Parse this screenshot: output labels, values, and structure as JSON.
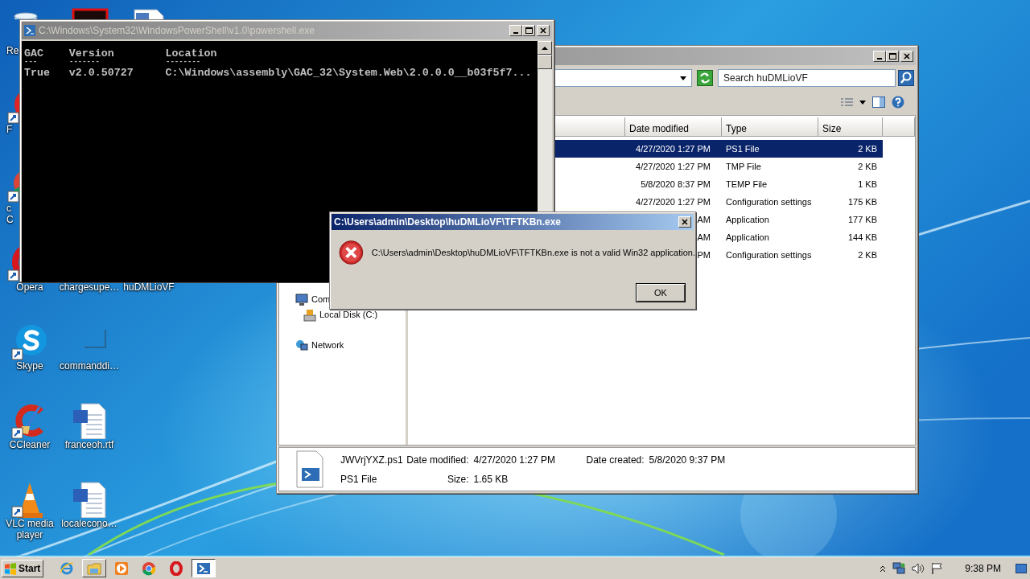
{
  "desktop_icons": [
    {
      "kind": "recycle-bin",
      "label": [
        "Re"
      ]
    },
    {
      "kind": "red-shortcut",
      "label": [
        "F"
      ]
    },
    {
      "kind": "chrome-shortcut",
      "label": [
        "c",
        "C"
      ]
    },
    {
      "kind": "opera",
      "label": [
        "Opera"
      ]
    },
    {
      "kind": "skype",
      "label": [
        "Skype"
      ]
    },
    {
      "kind": "ccleaner",
      "label": [
        "CCleaner"
      ]
    },
    {
      "kind": "vlc",
      "label": [
        "VLC media",
        "player"
      ]
    },
    {
      "kind": "red-box"
    },
    {
      "kind": "label-only",
      "label": [
        "chargesupe…"
      ]
    },
    {
      "kind": "blank",
      "label": [
        "commanddi…"
      ]
    },
    {
      "kind": "word",
      "label": [
        "franceoh.rtf"
      ]
    },
    {
      "kind": "word",
      "label": [
        "localecono…"
      ]
    },
    {
      "kind": "document"
    },
    {
      "kind": "label-only",
      "label": [
        "huDMLioVF"
      ]
    }
  ],
  "console_window": {
    "title": "C:\\Windows\\System32\\WindowsPowerShell\\v1.0\\powershell.exe",
    "lines": [
      [
        "GAC",
        "Version",
        "Location"
      ],
      [
        "---",
        "-------",
        "--------"
      ],
      [
        "True",
        "v2.0.50727",
        "C:\\Windows\\assembly\\GAC_32\\System.Web\\2.0.0.0__b03f5f7..."
      ]
    ]
  },
  "explorer_window": {
    "search": {
      "placeholder": "Search huDMLioVF"
    },
    "columns": [
      "Date modified",
      "Type",
      "Size"
    ],
    "rows": [
      {
        "date_modified": "4/27/2020 1:27 PM",
        "type": "PS1 File",
        "size": "2 KB",
        "selected": true
      },
      {
        "date_modified": "4/27/2020 1:27 PM",
        "type": "TMP File",
        "size": "2 KB",
        "selected": false
      },
      {
        "date_modified": "5/8/2020 8:37 PM",
        "type": "TEMP File",
        "size": "1 KB",
        "selected": false
      },
      {
        "date_modified": "4/27/2020 1:27 PM",
        "type": "Configuration settings",
        "size": "175 KB",
        "selected": false
      },
      {
        "date_modified": "AM",
        "type": "Application",
        "size": "177 KB",
        "selected": false
      },
      {
        "date_modified": "AM",
        "type": "Application",
        "size": "144 KB",
        "selected": false
      },
      {
        "date_modified": "PM",
        "type": "Configuration settings",
        "size": "2 KB",
        "selected": false
      }
    ],
    "navigation": [
      {
        "kind": "computer",
        "label": "Com",
        "children": [
          {
            "kind": "drive",
            "label": "Local Disk (C:)"
          }
        ]
      },
      {
        "kind": "network",
        "label": "Network"
      }
    ],
    "details": {
      "name": "JWVrjYXZ.ps1",
      "type": "PS1 File",
      "fields": [
        {
          "label": "Date modified:",
          "value": "4/27/2020 1:27 PM"
        },
        {
          "label": "Size:",
          "value": "1.65 KB"
        },
        {
          "label": "Date created:",
          "value": "5/8/2020 9:37 PM"
        }
      ]
    }
  },
  "error_dialog": {
    "title": "C:\\Users\\admin\\Desktop\\huDMLioVF\\TFTKBn.exe",
    "message": "C:\\Users\\admin\\Desktop\\huDMLioVF\\TFTKBn.exe is not a valid Win32 application.",
    "buttons": [
      "OK"
    ]
  },
  "taskbar": {
    "start_label": "Start",
    "items": [
      {
        "kind": "ie",
        "running": false,
        "selected": false
      },
      {
        "kind": "explorer",
        "running": true,
        "selected": false
      },
      {
        "kind": "media",
        "running": false,
        "selected": false
      },
      {
        "kind": "chrome",
        "running": false,
        "selected": false
      },
      {
        "kind": "opera",
        "running": false,
        "selected": false
      },
      {
        "kind": "powershell",
        "running": true,
        "selected": true
      }
    ],
    "clock": "9:38 PM"
  }
}
